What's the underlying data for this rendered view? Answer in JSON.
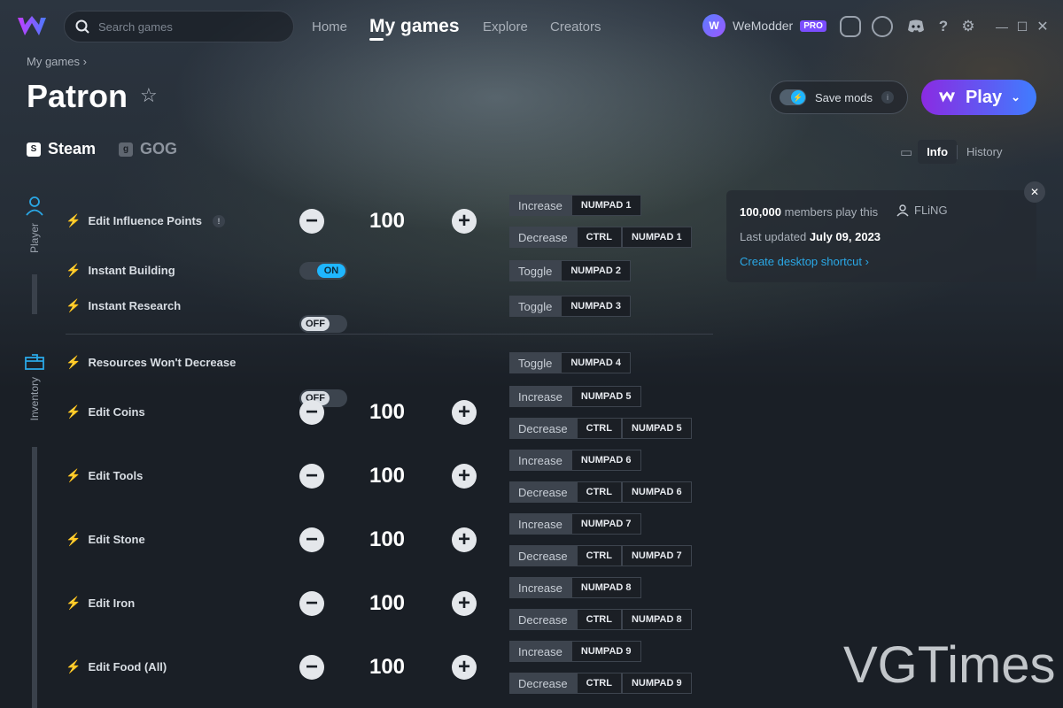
{
  "top_nav": {
    "search_placeholder": "Search games",
    "home": "Home",
    "my_games": "My games",
    "explore": "Explore",
    "creators": "Creators"
  },
  "account": {
    "username": "WeModder",
    "badge": "PRO"
  },
  "header": {
    "breadcrumb": "My games",
    "title": "Patron",
    "save_mods": "Save mods",
    "play": "Play",
    "platforms": [
      "Steam",
      "GOG"
    ],
    "tabs": [
      "Info",
      "History"
    ]
  },
  "categories": [
    "Player",
    "Inventory"
  ],
  "mods": [
    {
      "name": "Edit Influence Points",
      "type": "number",
      "value": "100",
      "info": "!"
    },
    {
      "name": "Instant Building",
      "type": "toggle",
      "state": "ON"
    },
    {
      "name": "Instant Research",
      "type": "toggle",
      "state": "OFF"
    },
    {
      "name": "Resources Won't Decrease",
      "type": "toggle",
      "state": "OFF"
    },
    {
      "name": "Edit Coins",
      "type": "number",
      "value": "100"
    },
    {
      "name": "Edit Tools",
      "type": "number",
      "value": "100"
    },
    {
      "name": "Edit Stone",
      "type": "number",
      "value": "100"
    },
    {
      "name": "Edit Iron",
      "type": "number",
      "value": "100"
    },
    {
      "name": "Edit Food (All)",
      "type": "number",
      "value": "100"
    }
  ],
  "hotkeys": [
    {
      "action": "Increase",
      "keys": [
        "NUMPAD 1"
      ]
    },
    {
      "action": "Decrease",
      "keys": [
        "CTRL",
        "NUMPAD 1"
      ]
    },
    {
      "action": "Toggle",
      "keys": [
        "NUMPAD 2"
      ]
    },
    {
      "action": "Toggle",
      "keys": [
        "NUMPAD 3"
      ]
    },
    {
      "action": "Toggle",
      "keys": [
        "NUMPAD 4"
      ]
    },
    {
      "action": "Increase",
      "keys": [
        "NUMPAD 5"
      ]
    },
    {
      "action": "Decrease",
      "keys": [
        "CTRL",
        "NUMPAD 5"
      ]
    },
    {
      "action": "Increase",
      "keys": [
        "NUMPAD 6"
      ]
    },
    {
      "action": "Decrease",
      "keys": [
        "CTRL",
        "NUMPAD 6"
      ]
    },
    {
      "action": "Increase",
      "keys": [
        "NUMPAD 7"
      ]
    },
    {
      "action": "Decrease",
      "keys": [
        "CTRL",
        "NUMPAD 7"
      ]
    },
    {
      "action": "Increase",
      "keys": [
        "NUMPAD 8"
      ]
    },
    {
      "action": "Decrease",
      "keys": [
        "CTRL",
        "NUMPAD 8"
      ]
    },
    {
      "action": "Increase",
      "keys": [
        "NUMPAD 9"
      ]
    },
    {
      "action": "Decrease",
      "keys": [
        "CTRL",
        "NUMPAD 9"
      ]
    }
  ],
  "info_card": {
    "members_count": "100,000",
    "members_text": "members play this",
    "author": "FLiNG",
    "updated_label": "Last updated",
    "updated_date": "July 09, 2023",
    "shortcut": "Create desktop shortcut"
  },
  "watermark": "VGTimes",
  "colors": {
    "accent": "#1fb6ff",
    "play_start": "#8a2be2",
    "play_end": "#3f7dff",
    "pro": "#7b4dff"
  }
}
